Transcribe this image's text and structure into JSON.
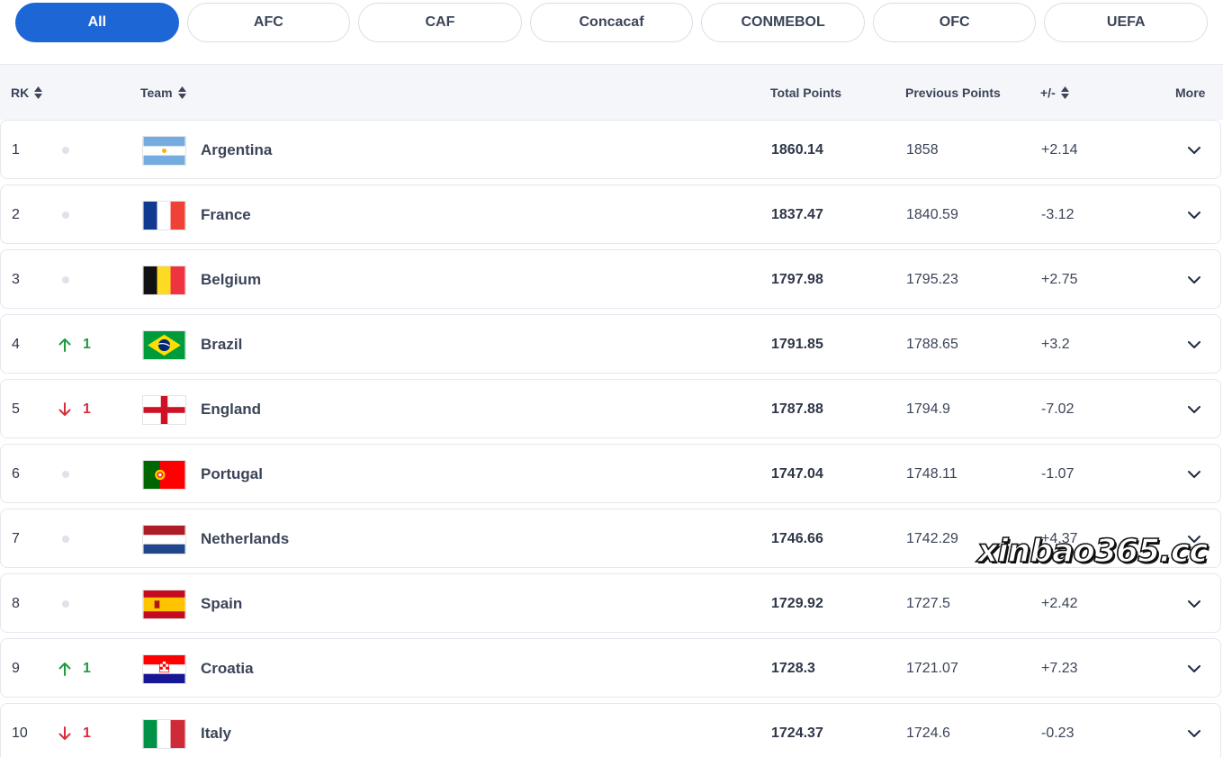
{
  "tabs": [
    "All",
    "AFC",
    "CAF",
    "Concacaf",
    "CONMEBOL",
    "OFC",
    "UEFA"
  ],
  "active_tab": "All",
  "columns": {
    "rank": "RK",
    "team": "Team",
    "total": "Total Points",
    "previous": "Previous Points",
    "diff": "+/-",
    "more": "More"
  },
  "rows": [
    {
      "rank": "1",
      "move_dir": "none",
      "move": "",
      "flag": "flag-argentina-icon",
      "team": "Argentina",
      "total": "1860.14",
      "previous": "1858",
      "diff": "+2.14"
    },
    {
      "rank": "2",
      "move_dir": "none",
      "move": "",
      "flag": "flag-france-icon",
      "team": "France",
      "total": "1837.47",
      "previous": "1840.59",
      "diff": "-3.12"
    },
    {
      "rank": "3",
      "move_dir": "none",
      "move": "",
      "flag": "flag-belgium-icon",
      "team": "Belgium",
      "total": "1797.98",
      "previous": "1795.23",
      "diff": "+2.75"
    },
    {
      "rank": "4",
      "move_dir": "up",
      "move": "1",
      "flag": "flag-brazil-icon",
      "team": "Brazil",
      "total": "1791.85",
      "previous": "1788.65",
      "diff": "+3.2"
    },
    {
      "rank": "5",
      "move_dir": "down",
      "move": "1",
      "flag": "flag-england-icon",
      "team": "England",
      "total": "1787.88",
      "previous": "1794.9",
      "diff": "-7.02"
    },
    {
      "rank": "6",
      "move_dir": "none",
      "move": "",
      "flag": "flag-portugal-icon",
      "team": "Portugal",
      "total": "1747.04",
      "previous": "1748.11",
      "diff": "-1.07"
    },
    {
      "rank": "7",
      "move_dir": "none",
      "move": "",
      "flag": "flag-netherlands-icon",
      "team": "Netherlands",
      "total": "1746.66",
      "previous": "1742.29",
      "diff": "+4.37"
    },
    {
      "rank": "8",
      "move_dir": "none",
      "move": "",
      "flag": "flag-spain-icon",
      "team": "Spain",
      "total": "1729.92",
      "previous": "1727.5",
      "diff": "+2.42"
    },
    {
      "rank": "9",
      "move_dir": "up",
      "move": "1",
      "flag": "flag-croatia-icon",
      "team": "Croatia",
      "total": "1728.3",
      "previous": "1721.07",
      "diff": "+7.23"
    },
    {
      "rank": "10",
      "move_dir": "down",
      "move": "1",
      "flag": "flag-italy-icon",
      "team": "Italy",
      "total": "1724.37",
      "previous": "1724.6",
      "diff": "-0.23"
    }
  ],
  "watermark": "xinbao365.cc",
  "colors": {
    "accent": "#1d66d6",
    "move_up": "#1e9c3e",
    "move_down": "#d62e3b"
  },
  "icons": {
    "sort": "sort-arrows-icon",
    "expand": "chevron-down-icon",
    "move_up": "arrow-up-icon",
    "move_down": "arrow-down-icon",
    "no_change": "no-change-dot-icon"
  }
}
